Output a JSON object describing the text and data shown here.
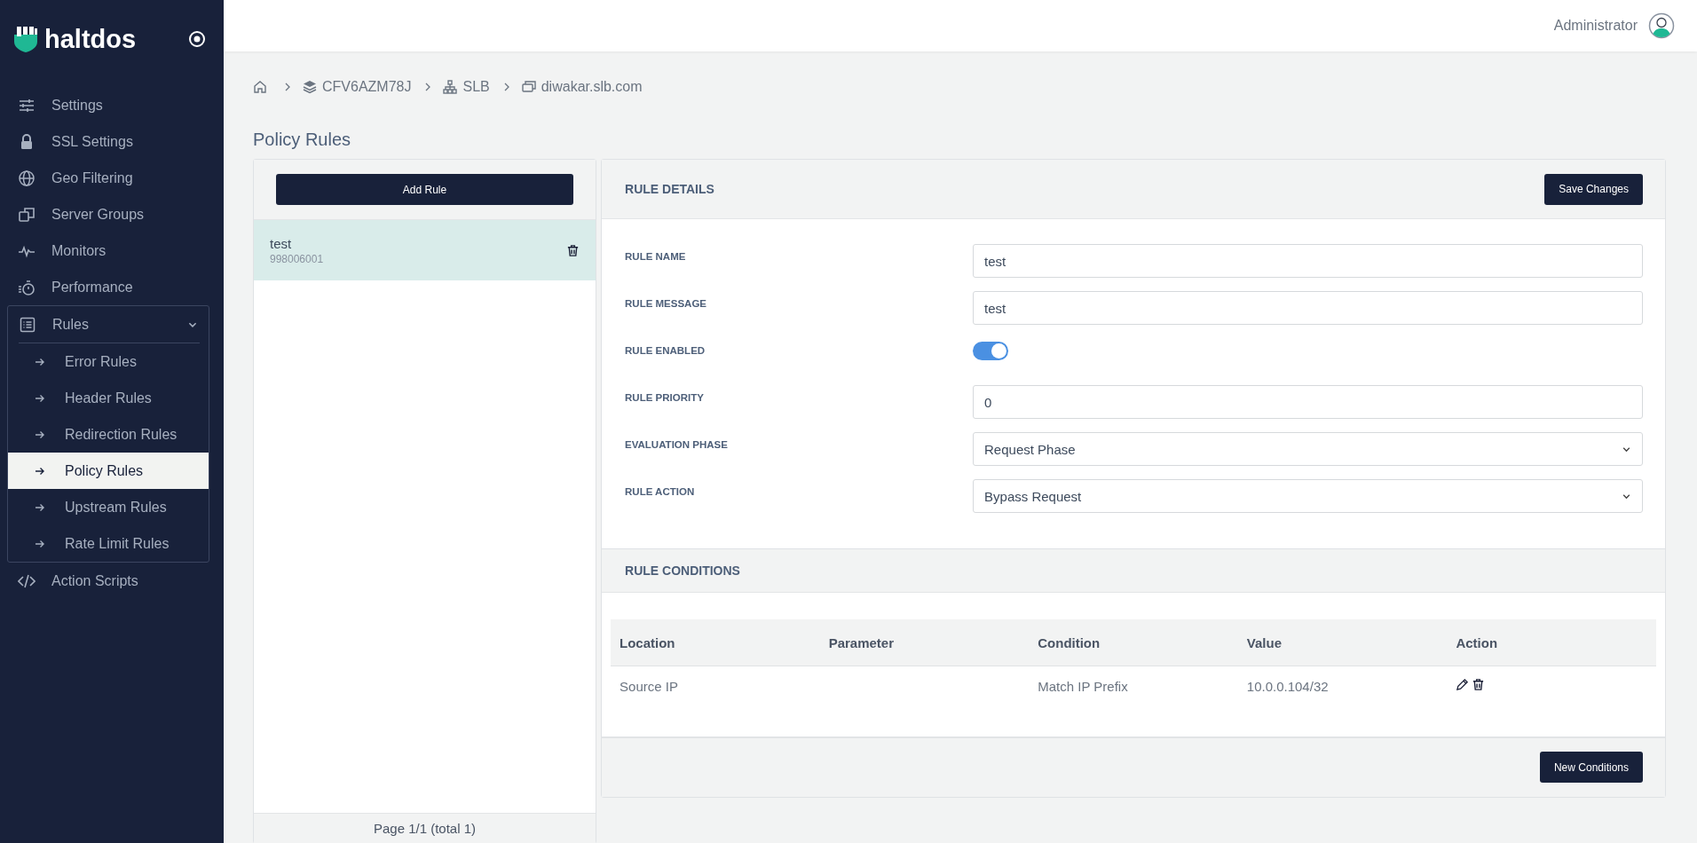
{
  "sidebar": {
    "logo": "haltdos",
    "items": [
      {
        "label": "Settings",
        "kind": "link"
      },
      {
        "label": "SSL Settings",
        "kind": "link"
      },
      {
        "label": "Geo Filtering",
        "kind": "link"
      },
      {
        "label": "Server Groups",
        "kind": "link"
      },
      {
        "label": "Monitors",
        "kind": "link"
      },
      {
        "label": "Performance",
        "kind": "link"
      },
      {
        "label": "Rules",
        "kind": "group",
        "expanded": true,
        "children": [
          {
            "label": "Error Rules",
            "selected": false
          },
          {
            "label": "Header Rules",
            "selected": false
          },
          {
            "label": "Redirection Rules",
            "selected": false
          },
          {
            "label": "Policy Rules",
            "selected": true
          },
          {
            "label": "Upstream Rules",
            "selected": false
          },
          {
            "label": "Rate Limit Rules",
            "selected": false
          }
        ]
      },
      {
        "label": "Action Scripts",
        "kind": "link"
      }
    ]
  },
  "header": {
    "user": "Administrator"
  },
  "breadcrumb": [
    "CFV6AZM78J",
    "SLB",
    "diwakar.slb.com"
  ],
  "page_title": "Policy Rules",
  "rule_list": {
    "add_button": "Add Rule",
    "rules": [
      {
        "name": "test",
        "id": "998006001",
        "selected": true
      }
    ],
    "pager": "Page 1/1 (total 1)"
  },
  "rule_details": {
    "title": "RULE DETAILS",
    "save_button": "Save Changes",
    "fields": [
      {
        "label": "RULE NAME",
        "kind": "text",
        "value": "test"
      },
      {
        "label": "RULE MESSAGE",
        "kind": "text",
        "value": "test"
      },
      {
        "label": "RULE ENABLED",
        "kind": "toggle",
        "on": true
      },
      {
        "label": "RULE PRIORITY",
        "kind": "text",
        "value": "0"
      },
      {
        "label": "EVALUATION PHASE",
        "kind": "select",
        "value": "Request Phase"
      },
      {
        "label": "RULE ACTION",
        "kind": "select",
        "value": "Bypass Request"
      }
    ]
  },
  "rule_conditions": {
    "title": "RULE CONDITIONS",
    "columns": [
      "Location",
      "Parameter",
      "Condition",
      "Value",
      "Action"
    ],
    "rows": [
      {
        "cells": [
          "Source IP",
          "",
          "Match IP Prefix",
          "10.0.0.104/32"
        ]
      }
    ],
    "new_button": "New Conditions"
  }
}
